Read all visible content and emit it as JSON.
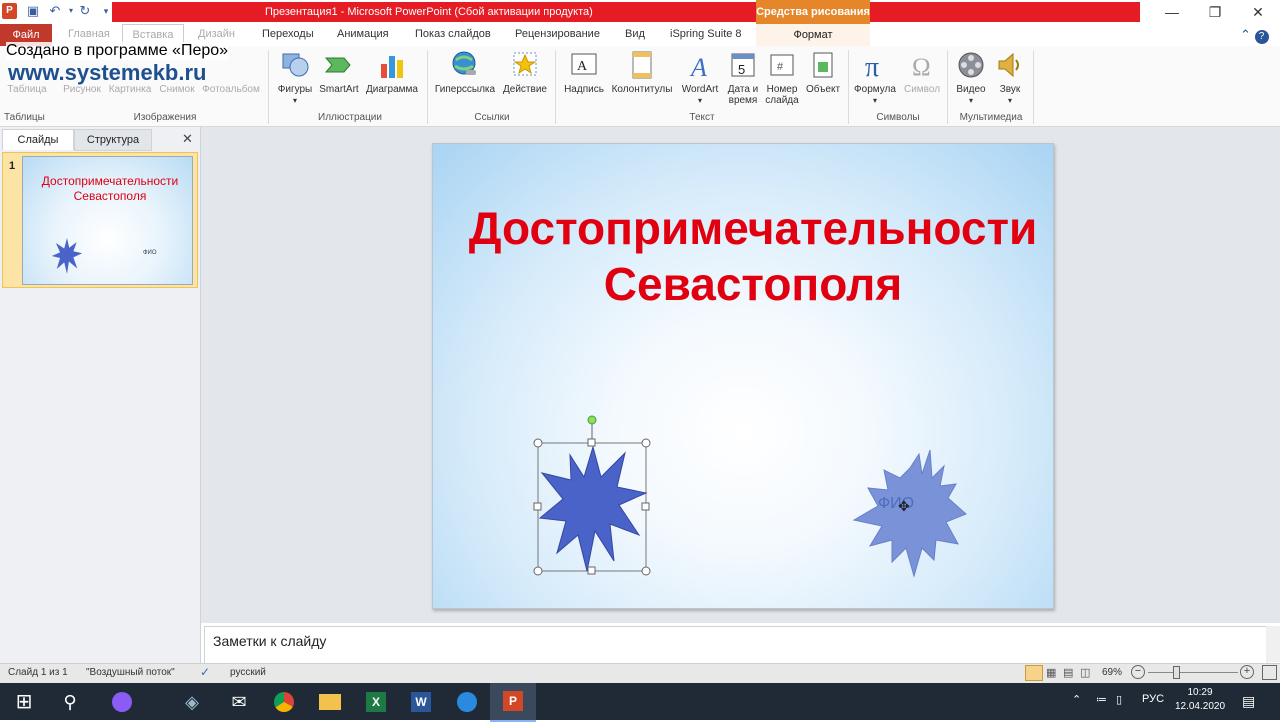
{
  "window": {
    "title": "Презентация1  -  Microsoft PowerPoint (Сбой активации продукта)",
    "context_tab_group": "Средства рисования",
    "controls": {
      "minimize": "—",
      "restore": "❐",
      "close": "✕"
    }
  },
  "tabs": [
    {
      "label": "Файл"
    },
    {
      "label": "Главная"
    },
    {
      "label": "Вставка"
    },
    {
      "label": "Дизайн"
    },
    {
      "label": "Переходы"
    },
    {
      "label": "Анимация"
    },
    {
      "label": "Показ слайдов"
    },
    {
      "label": "Рецензирование"
    },
    {
      "label": "Вид"
    },
    {
      "label": "iSpring Suite 8"
    },
    {
      "label": "Формат"
    }
  ],
  "ribbon": {
    "groups": {
      "tables": "Таблицы",
      "images": "Изображения",
      "illustrations": "Иллюстрации",
      "links": "Ссылки",
      "text": "Текст",
      "symbols": "Символы",
      "media": "Мультимедиа"
    },
    "buttons": {
      "table": "Таблица",
      "picture": "Рисунок",
      "clipart": "Картинка",
      "screenshot": "Снимок",
      "photoalbum": "Фотоальбом",
      "shapes": "Фигуры",
      "smartart": "SmartArt",
      "chart": "Диаграмма",
      "hyperlink": "Гиперссылка",
      "action": "Действие",
      "textbox": "Надпись",
      "headerfooter": "Колонтитулы",
      "wordart": "WordArt",
      "datetime_1": "Дата и",
      "datetime_2": "время",
      "slidenum_1": "Номер",
      "slidenum_2": "слайда",
      "object": "Объект",
      "equation": "Формула",
      "symbol": "Символ",
      "video": "Видео",
      "audio": "Звук"
    }
  },
  "watermark": {
    "line1": "Создано в программе «Перо»",
    "line2": "www.systemekb.ru"
  },
  "left_panel": {
    "tab_slides": "Слайды",
    "tab_outline": "Структура",
    "close": "✕",
    "thumbnail": {
      "number": "1",
      "title": "Достопримечательности Севастополя",
      "fio": "ФИО"
    }
  },
  "slide": {
    "title_line1": "Достопримечательности",
    "title_line2": "Севастополя",
    "subtitle_text": "ФИО",
    "shape_color": "#4a63c8",
    "shape2_color": "#7a93d8"
  },
  "notes": {
    "placeholder": "Заметки к слайду"
  },
  "statusbar": {
    "slide_info": "Слайд 1 из 1",
    "theme": "\"Воздушный поток\"",
    "language": "русский",
    "zoom": "69%"
  },
  "taskbar": {
    "language": "РУС",
    "time": "10:29",
    "date": "12.04.2020"
  },
  "colors": {
    "title_red": "#e00010",
    "titlebar_red": "#e51c23",
    "accent_orange": "#e6862a"
  }
}
